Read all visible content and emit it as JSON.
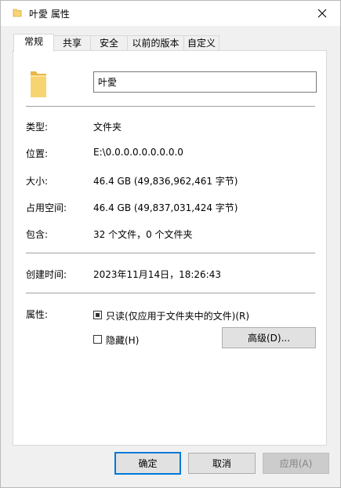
{
  "window": {
    "title": "叶愛 属性"
  },
  "tabs": [
    {
      "label": "常规",
      "active": true
    },
    {
      "label": "共享",
      "active": false
    },
    {
      "label": "安全",
      "active": false
    },
    {
      "label": "以前的版本",
      "active": false
    },
    {
      "label": "自定义",
      "active": false
    }
  ],
  "general": {
    "name_value": "叶愛",
    "type_label": "类型:",
    "type_value": "文件夹",
    "location_label": "位置:",
    "location_value": "E:\\0.0.0.0.0.0.0.0.0",
    "size_label": "大小:",
    "size_value": "46.4 GB (49,836,962,461 字节)",
    "disk_size_label": "占用空间:",
    "disk_size_value": "46.4 GB (49,837,031,424 字节)",
    "contains_label": "包含:",
    "contains_value": "32 个文件，0 个文件夹",
    "created_label": "创建时间:",
    "created_value": "2023年11月14日，18:26:43",
    "attributes_label": "属性:",
    "readonly_label": "只读(仅应用于文件夹中的文件)(R)",
    "readonly_state": "indeterminate",
    "hidden_label": "隐藏(H)",
    "hidden_state": "unchecked",
    "advanced_label": "高级(D)..."
  },
  "footer": {
    "ok_label": "确定",
    "cancel_label": "取消",
    "apply_label": "应用(A)"
  },
  "colors": {
    "folder": "#f7d472",
    "accent": "#0078d7"
  }
}
